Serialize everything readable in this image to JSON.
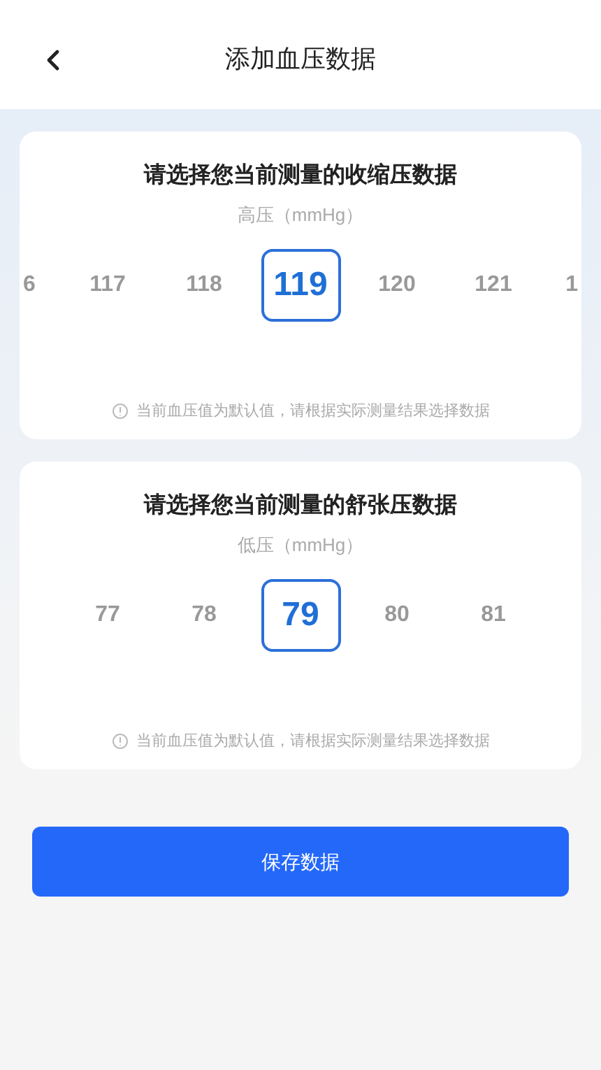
{
  "header": {
    "title": "添加血压数据"
  },
  "pickers": [
    {
      "title": "请选择您当前测量的收缩压数据",
      "unit": "高压（mmHg）",
      "hint": "当前血压值为默认值，请根据实际测量结果选择数据",
      "values": [
        {
          "label": "6",
          "kind": "partial",
          "selected": false
        },
        {
          "label": "117",
          "kind": "full",
          "selected": false
        },
        {
          "label": "118",
          "kind": "full",
          "selected": false
        },
        {
          "label": "119",
          "kind": "full",
          "selected": true
        },
        {
          "label": "120",
          "kind": "full",
          "selected": false
        },
        {
          "label": "121",
          "kind": "full",
          "selected": false
        },
        {
          "label": "1",
          "kind": "partial",
          "selected": false
        }
      ]
    },
    {
      "title": "请选择您当前测量的舒张压数据",
      "unit": "低压（mmHg）",
      "hint": "当前血压值为默认值，请根据实际测量结果选择数据",
      "values": [
        {
          "label": "77",
          "kind": "full",
          "selected": false
        },
        {
          "label": "78",
          "kind": "full",
          "selected": false
        },
        {
          "label": "79",
          "kind": "full",
          "selected": true
        },
        {
          "label": "80",
          "kind": "full",
          "selected": false
        },
        {
          "label": "81",
          "kind": "full",
          "selected": false
        }
      ]
    }
  ],
  "save_button": "保存数据"
}
